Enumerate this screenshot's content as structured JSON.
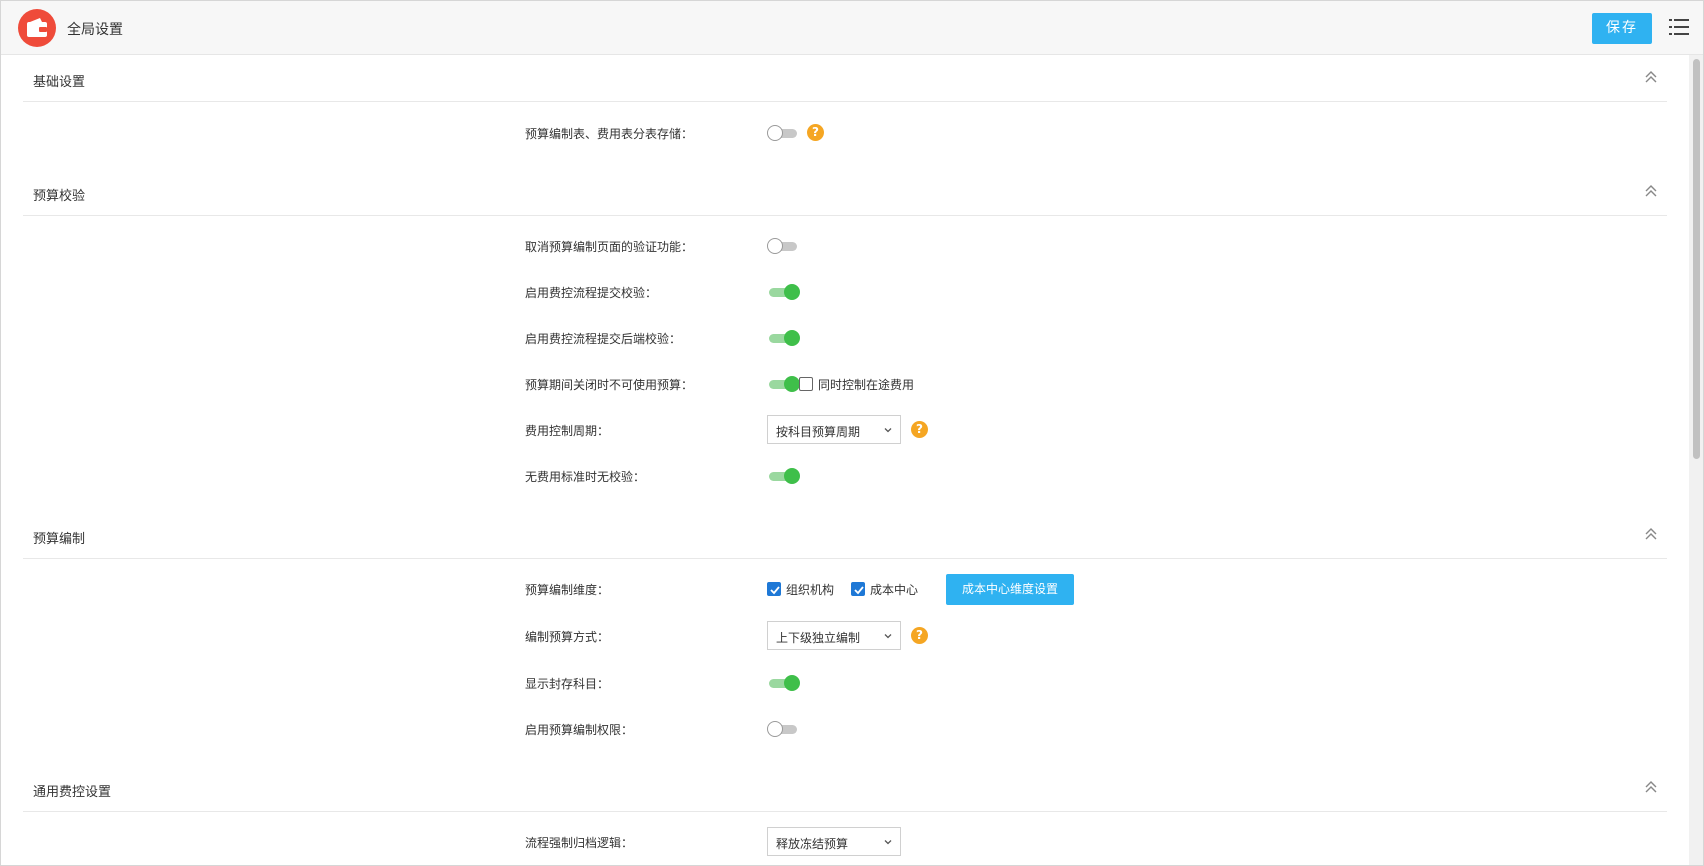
{
  "header": {
    "title": "全局设置",
    "save_label": "保存",
    "logo_icon": "wallet-icon",
    "menu_icon": "list-menu-icon"
  },
  "colors": {
    "accent": "#2fb2f1",
    "toggle_on": "#3fbf4a",
    "help": "#f5a623",
    "logo": "#ef4b3a"
  },
  "sections": {
    "basic": {
      "title": "基础设置",
      "rows": {
        "split_storage": {
          "label": "预算编制表、费用表分表存储：",
          "value": false
        }
      }
    },
    "validation": {
      "title": "预算校验",
      "rows": {
        "cancel_verify": {
          "label": "取消预算编制页面的验证功能：",
          "value": false
        },
        "flow_submit_check": {
          "label": "启用费控流程提交校验：",
          "value": true
        },
        "flow_submit_backend_check": {
          "label": "启用费控流程提交后端校验：",
          "value": true
        },
        "period_closed": {
          "label": "预算期间关闭时不可使用预算：",
          "value": true,
          "checkbox_label": "同时控制在途费用",
          "checkbox_checked": false
        },
        "control_period": {
          "label": "费用控制周期：",
          "value": "按科目预算周期"
        },
        "no_standard": {
          "label": "无费用标准时无校验：",
          "value": true
        }
      }
    },
    "compile": {
      "title": "预算编制",
      "rows": {
        "dimension": {
          "label": "预算编制维度：",
          "option1": "组织机构",
          "option1_checked": true,
          "option2": "成本中心",
          "option2_checked": true,
          "button_label": "成本中心维度设置"
        },
        "method": {
          "label": "编制预算方式：",
          "value": "上下级独立编制"
        },
        "show_archived": {
          "label": "显示封存科目：",
          "value": true
        },
        "compile_permission": {
          "label": "启用预算编制权限：",
          "value": false
        }
      }
    },
    "general": {
      "title": "通用费控设置",
      "rows": {
        "force_archive": {
          "label": "流程强制归档逻辑：",
          "value": "释放冻结预算"
        }
      }
    }
  }
}
